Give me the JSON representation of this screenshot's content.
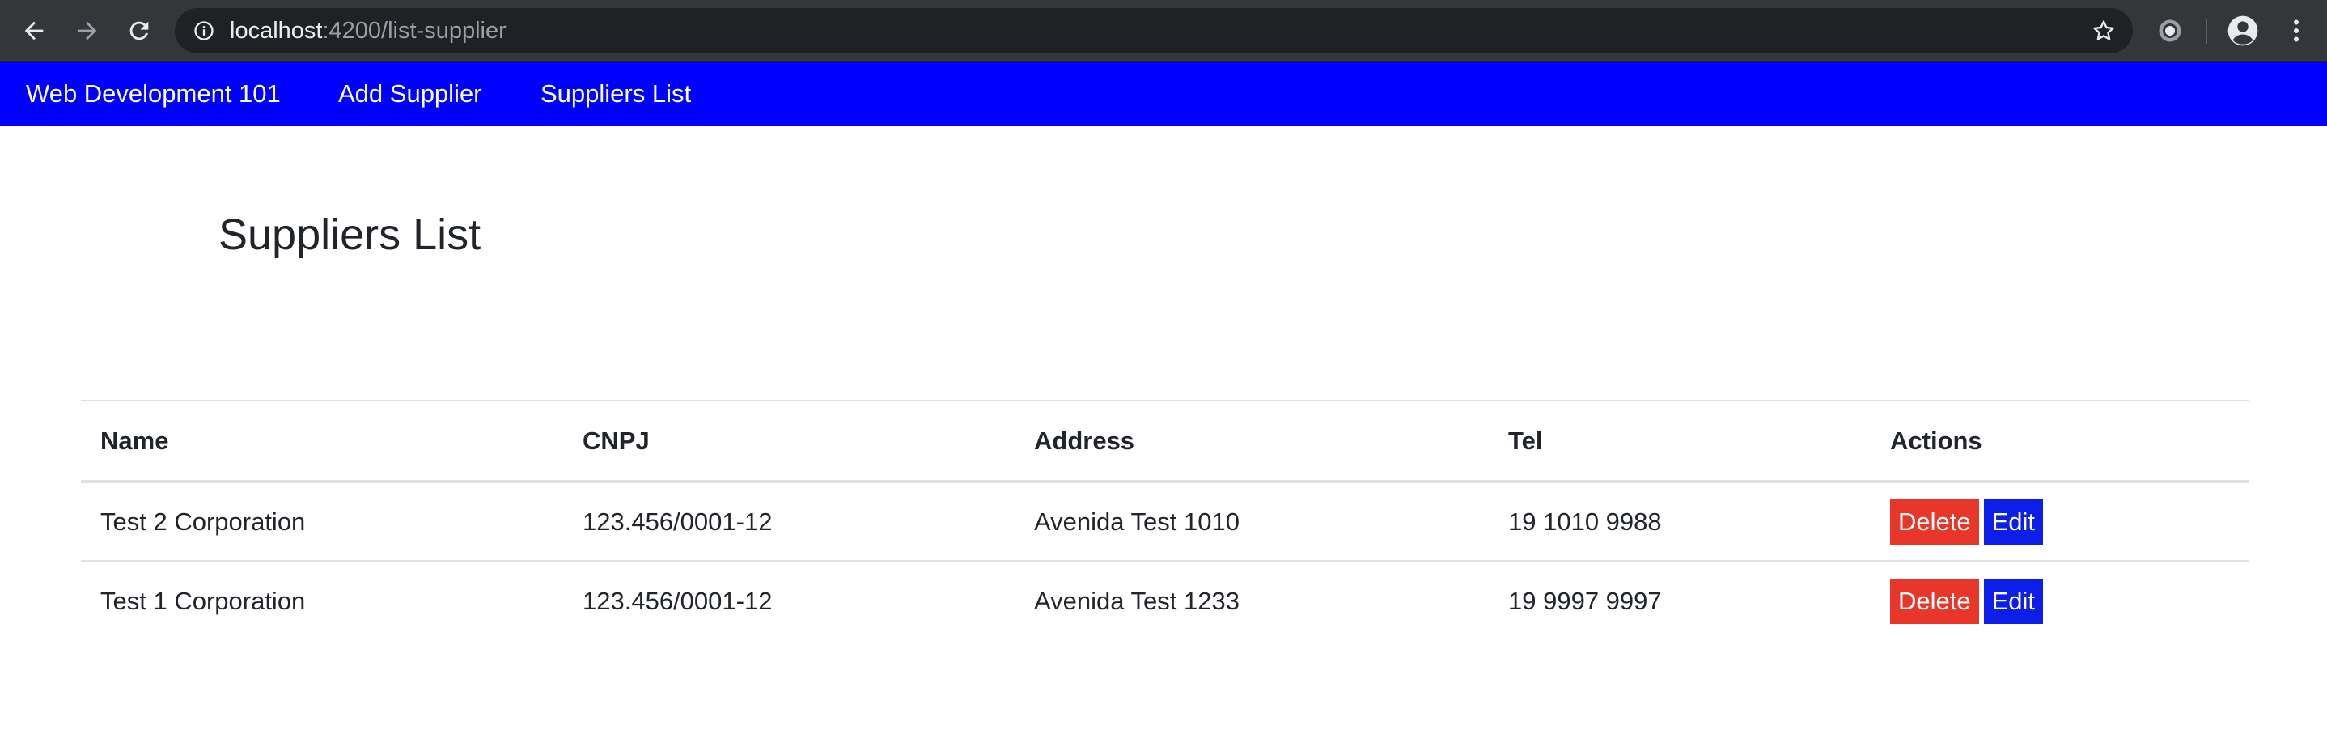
{
  "browser": {
    "url_host": "localhost",
    "url_rest": ":4200/list-supplier"
  },
  "navbar": {
    "brand": "Web Development 101",
    "links": [
      "Add Supplier",
      "Suppliers List"
    ],
    "background": "#0000ff"
  },
  "page": {
    "title": "Suppliers List"
  },
  "table": {
    "headers": [
      "Name",
      "CNPJ",
      "Address",
      "Tel",
      "Actions"
    ],
    "rows": [
      {
        "name": "Test 2 Corporation",
        "cnpj": "123.456/0001-12",
        "address": "Avenida Test 1010",
        "tel": "19 1010 9988",
        "delete_label": "Delete",
        "edit_label": "Edit"
      },
      {
        "name": "Test 1 Corporation",
        "cnpj": "123.456/0001-12",
        "address": "Avenida Test 1233",
        "tel": "19 9997 9997",
        "delete_label": "Delete",
        "edit_label": "Edit"
      }
    ]
  },
  "colors": {
    "delete": "#e9362a",
    "edit": "#0d1ee8",
    "chrome": "#35363a"
  },
  "icons": [
    "back-arrow-icon",
    "forward-arrow-icon",
    "reload-icon",
    "info-icon",
    "star-icon",
    "extension-icon",
    "profile-icon",
    "menu-icon"
  ]
}
